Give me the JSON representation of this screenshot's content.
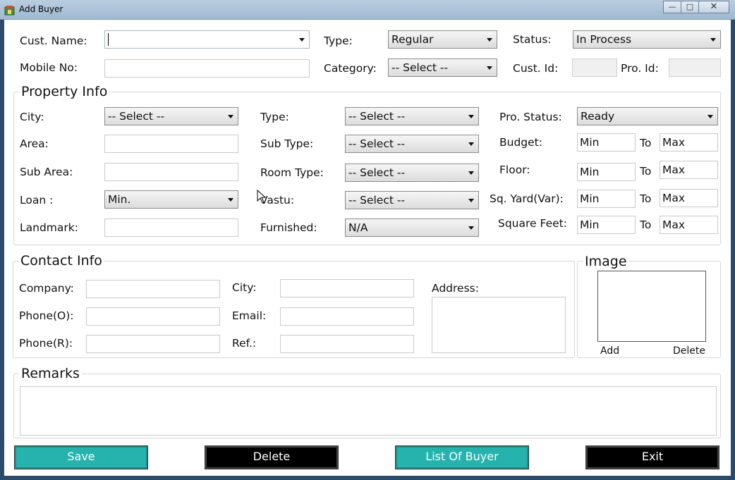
{
  "window": {
    "title": "Add Buyer"
  },
  "top": {
    "cust_name_label": "Cust. Name:",
    "cust_name_value": "",
    "type_label": "Type:",
    "type_value": "Regular",
    "status_label": "Status:",
    "status_value": "In Process",
    "mobile_label": "Mobile No:",
    "mobile_value": "",
    "category_label": "Category:",
    "category_value": "-- Select --",
    "cust_id_label": "Cust. Id:",
    "cust_id_value": "",
    "pro_id_label": "Pro. Id:",
    "pro_id_value": ""
  },
  "property": {
    "header": "Property Info",
    "city_label": "City:",
    "city_value": "-- Select --",
    "area_label": "Area:",
    "area_value": "",
    "sub_area_label": "Sub Area:",
    "sub_area_value": "",
    "loan_label": "Loan :",
    "loan_value": "Min.",
    "landmark_label": "Landmark:",
    "landmark_value": "",
    "type_label": "Type:",
    "type_value": "-- Select --",
    "sub_type_label": "Sub Type:",
    "sub_type_value": "-- Select --",
    "room_type_label": "Room Type:",
    "room_type_value": "-- Select --",
    "vastu_label": "Vastu:",
    "vastu_value": "-- Select --",
    "furnished_label": "Furnished:",
    "furnished_value": "N/A",
    "pro_status_label": "Pro. Status:",
    "pro_status_value": "Ready",
    "budget_label": "Budget:",
    "floor_label": "Floor:",
    "sq_yard_label": "Sq. Yard(Var):",
    "square_feet_label": "Square Feet:",
    "min_text": "Min",
    "max_text": "Max",
    "to_text": "To"
  },
  "contact": {
    "header": "Contact Info",
    "company_label": "Company:",
    "company_value": "",
    "phone_o_label": "Phone(O):",
    "phone_o_value": "",
    "phone_r_label": "Phone(R):",
    "phone_r_value": "",
    "city_label": "City:",
    "city_value": "",
    "email_label": "Email:",
    "email_value": "",
    "ref_label": "Ref.:",
    "ref_value": "",
    "address_label": "Address:",
    "address_value": ""
  },
  "image": {
    "header": "Image",
    "add_label": "Add",
    "delete_label": "Delete"
  },
  "remarks": {
    "header": "Remarks",
    "value": ""
  },
  "buttons": {
    "save": "Save",
    "delete": "Delete",
    "list": "List Of Buyer",
    "exit": "Exit"
  },
  "colors": {
    "teal": "#27b3ad",
    "black": "#000000",
    "titlebar": "#b9cde0"
  }
}
